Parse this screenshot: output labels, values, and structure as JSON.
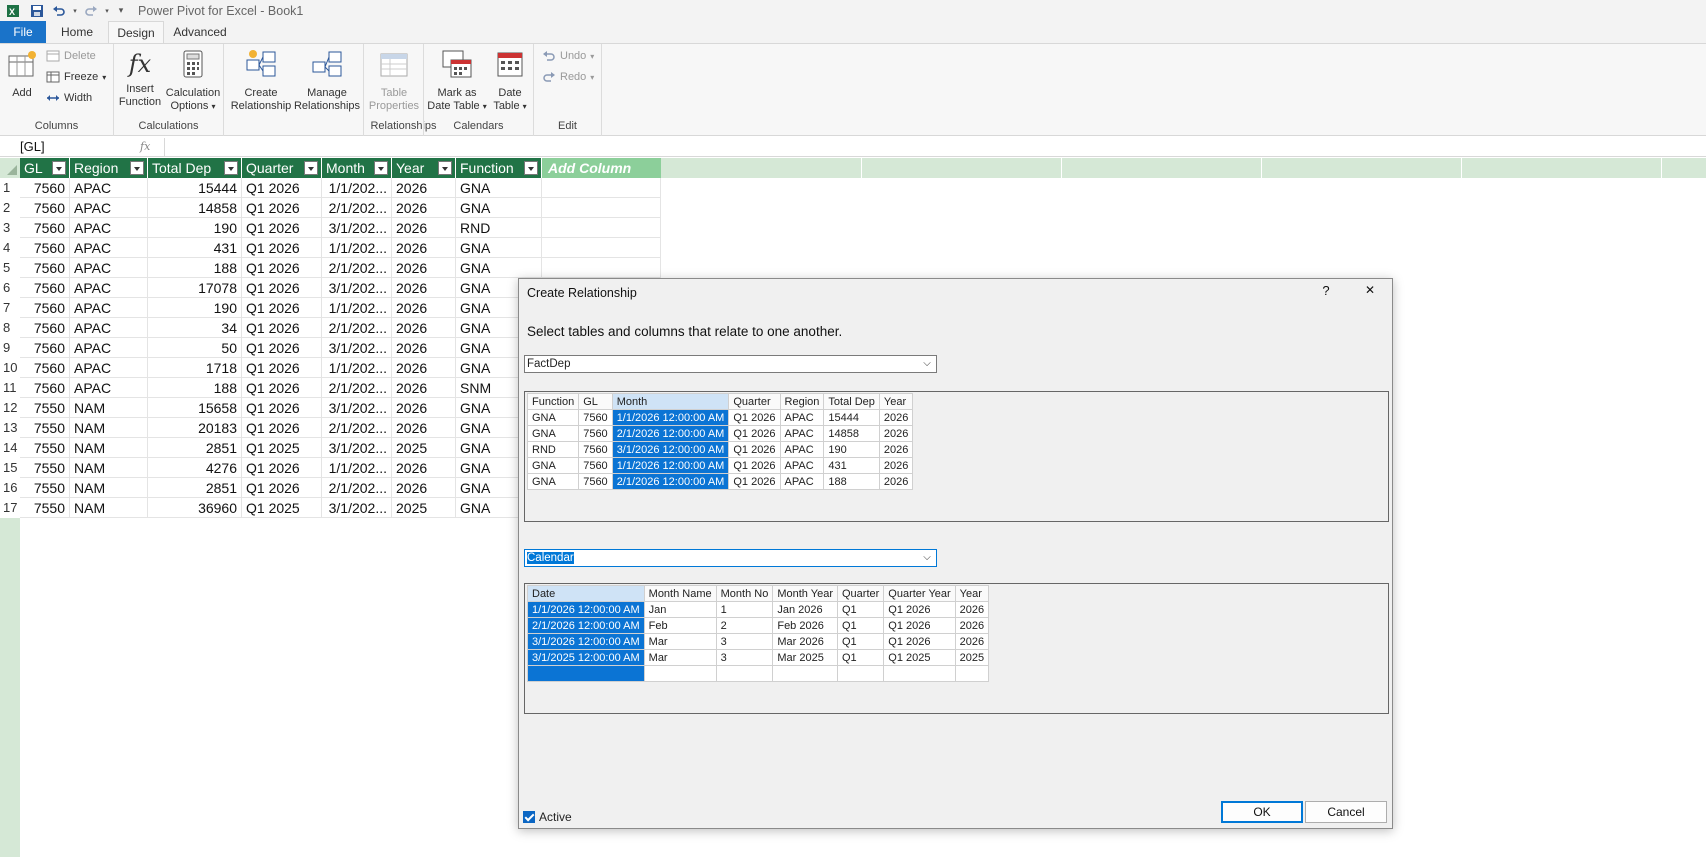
{
  "app": {
    "title": "Power Pivot for Excel - Book1",
    "qat": [
      "excel-icon",
      "save-icon",
      "undo-icon",
      "redo-icon",
      "customize-icon"
    ]
  },
  "ribbon": {
    "tabs": [
      {
        "label": "File"
      },
      {
        "label": "Home"
      },
      {
        "label": "Design"
      },
      {
        "label": "Advanced"
      }
    ],
    "active_tab": "Design",
    "groups": {
      "columns": {
        "label": "Columns",
        "add": "Add",
        "delete": "Delete",
        "freeze": "Freeze",
        "width": "Width"
      },
      "calculations": {
        "label": "Calculations",
        "insert_function_1": "Insert",
        "insert_function_2": "Function",
        "calc_options_1": "Calculation",
        "calc_options_2": "Options"
      },
      "relationships": {
        "label": "Relationships",
        "create_1": "Create",
        "create_2": "Relationship",
        "manage_1": "Manage",
        "manage_2": "Relationships",
        "table_props_1": "Table",
        "table_props_2": "Properties"
      },
      "calendars": {
        "label": "Calendars",
        "mark_1": "Mark as",
        "mark_2": "Date Table",
        "date_1": "Date",
        "date_2": "Table"
      },
      "edit": {
        "label": "Edit",
        "undo": "Undo",
        "redo": "Redo"
      }
    }
  },
  "formula_bar": {
    "name_box": "[GL]",
    "fx": "fx",
    "formula": ""
  },
  "grid": {
    "columns": [
      "GL",
      "Region",
      "Total Dep",
      "Quarter",
      "Month",
      "Year",
      "Function"
    ],
    "add_column": "Add Column",
    "rows": [
      [
        "1",
        "7560",
        "APAC",
        "15444",
        "Q1 2026",
        "1/1/202...",
        "2026",
        "GNA"
      ],
      [
        "2",
        "7560",
        "APAC",
        "14858",
        "Q1 2026",
        "2/1/202...",
        "2026",
        "GNA"
      ],
      [
        "3",
        "7560",
        "APAC",
        "190",
        "Q1 2026",
        "3/1/202...",
        "2026",
        "RND"
      ],
      [
        "4",
        "7560",
        "APAC",
        "431",
        "Q1 2026",
        "1/1/202...",
        "2026",
        "GNA"
      ],
      [
        "5",
        "7560",
        "APAC",
        "188",
        "Q1 2026",
        "2/1/202...",
        "2026",
        "GNA"
      ],
      [
        "6",
        "7560",
        "APAC",
        "17078",
        "Q1 2026",
        "3/1/202...",
        "2026",
        "GNA"
      ],
      [
        "7",
        "7560",
        "APAC",
        "190",
        "Q1 2026",
        "1/1/202...",
        "2026",
        "GNA"
      ],
      [
        "8",
        "7560",
        "APAC",
        "34",
        "Q1 2026",
        "2/1/202...",
        "2026",
        "GNA"
      ],
      [
        "9",
        "7560",
        "APAC",
        "50",
        "Q1 2026",
        "3/1/202...",
        "2026",
        "GNA"
      ],
      [
        "10",
        "7560",
        "APAC",
        "1718",
        "Q1 2026",
        "1/1/202...",
        "2026",
        "GNA"
      ],
      [
        "11",
        "7560",
        "APAC",
        "188",
        "Q1 2026",
        "2/1/202...",
        "2026",
        "SNM"
      ],
      [
        "12",
        "7550",
        "NAM",
        "15658",
        "Q1 2026",
        "3/1/202...",
        "2026",
        "GNA"
      ],
      [
        "13",
        "7550",
        "NAM",
        "20183",
        "Q1 2026",
        "2/1/202...",
        "2026",
        "GNA"
      ],
      [
        "14",
        "7550",
        "NAM",
        "2851",
        "Q1 2025",
        "3/1/202...",
        "2025",
        "GNA"
      ],
      [
        "15",
        "7550",
        "NAM",
        "4276",
        "Q1 2026",
        "1/1/202...",
        "2026",
        "GNA"
      ],
      [
        "16",
        "7550",
        "NAM",
        "2851",
        "Q1 2026",
        "2/1/202...",
        "2026",
        "GNA"
      ],
      [
        "17",
        "7550",
        "NAM",
        "36960",
        "Q1 2025",
        "3/1/202...",
        "2025",
        "GNA"
      ]
    ]
  },
  "dialog": {
    "title": "Create Relationship",
    "help": "?",
    "close": "✕",
    "instruction": "Select tables and columns that relate to one another.",
    "table1": {
      "selected": "FactDep",
      "columns": [
        "Function",
        "GL",
        "Month",
        "Quarter",
        "Region",
        "Total Dep",
        "Year"
      ],
      "selected_column": "Month",
      "rows": [
        [
          "GNA",
          "7560",
          "1/1/2026 12:00:00 AM",
          "Q1 2026",
          "APAC",
          "15444",
          "2026"
        ],
        [
          "GNA",
          "7560",
          "2/1/2026 12:00:00 AM",
          "Q1 2026",
          "APAC",
          "14858",
          "2026"
        ],
        [
          "RND",
          "7560",
          "3/1/2026 12:00:00 AM",
          "Q1 2026",
          "APAC",
          "190",
          "2026"
        ],
        [
          "GNA",
          "7560",
          "1/1/2026 12:00:00 AM",
          "Q1 2026",
          "APAC",
          "431",
          "2026"
        ],
        [
          "GNA",
          "7560",
          "2/1/2026 12:00:00 AM",
          "Q1 2026",
          "APAC",
          "188",
          "2026"
        ]
      ]
    },
    "table2": {
      "selected": "Calendar",
      "columns": [
        "Date",
        "Month Name",
        "Month No",
        "Month Year",
        "Quarter",
        "Quarter Year",
        "Year"
      ],
      "selected_column": "Date",
      "rows": [
        [
          "1/1/2026 12:00:00 AM",
          "Jan",
          "1",
          "Jan 2026",
          "Q1",
          "Q1 2026",
          "2026"
        ],
        [
          "2/1/2026 12:00:00 AM",
          "Feb",
          "2",
          "Feb 2026",
          "Q1",
          "Q1 2026",
          "2026"
        ],
        [
          "3/1/2026 12:00:00 AM",
          "Mar",
          "3",
          "Mar 2026",
          "Q1",
          "Q1 2026",
          "2026"
        ],
        [
          "3/1/2025 12:00:00 AM",
          "Mar",
          "3",
          "Mar 2025",
          "Q1",
          "Q1 2025",
          "2025"
        ],
        [
          "",
          "",
          "",
          "",
          "",
          "",
          ""
        ]
      ]
    },
    "active_label": "Active",
    "active_checked": true,
    "ok": "OK",
    "cancel": "Cancel"
  },
  "colors": {
    "header_green": "#217346",
    "add_column_green": "#8ccf9a",
    "rowheader_green": "#d5e8d6",
    "selection_blue": "#0b74d4",
    "file_tab_blue": "#1a73c9"
  }
}
